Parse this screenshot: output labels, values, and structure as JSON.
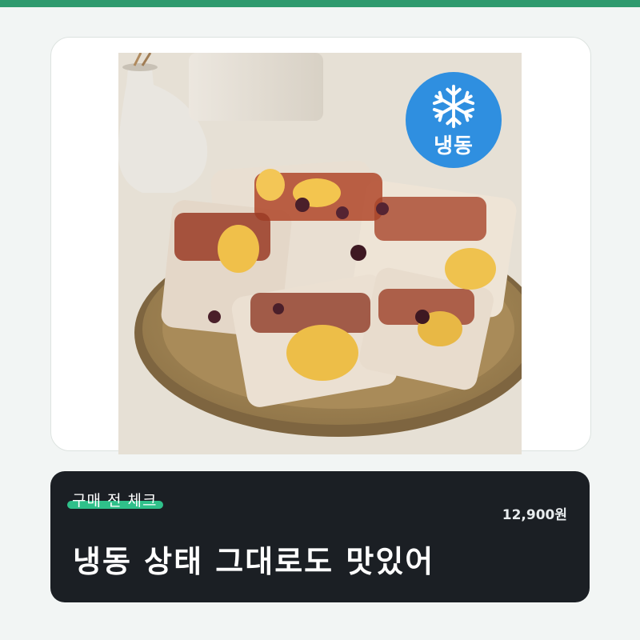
{
  "badge": {
    "label": "냉동",
    "icon": "snowflake-icon",
    "color": "#2f8fe0"
  },
  "info": {
    "tag": "구매 전 체크",
    "price": "12,900원",
    "headline": "냉동 상태 그대로도 맛있어"
  },
  "colors": {
    "accent": "#2f9a6e",
    "highlight": "#2fc08a",
    "panel": "#1b1f24"
  }
}
